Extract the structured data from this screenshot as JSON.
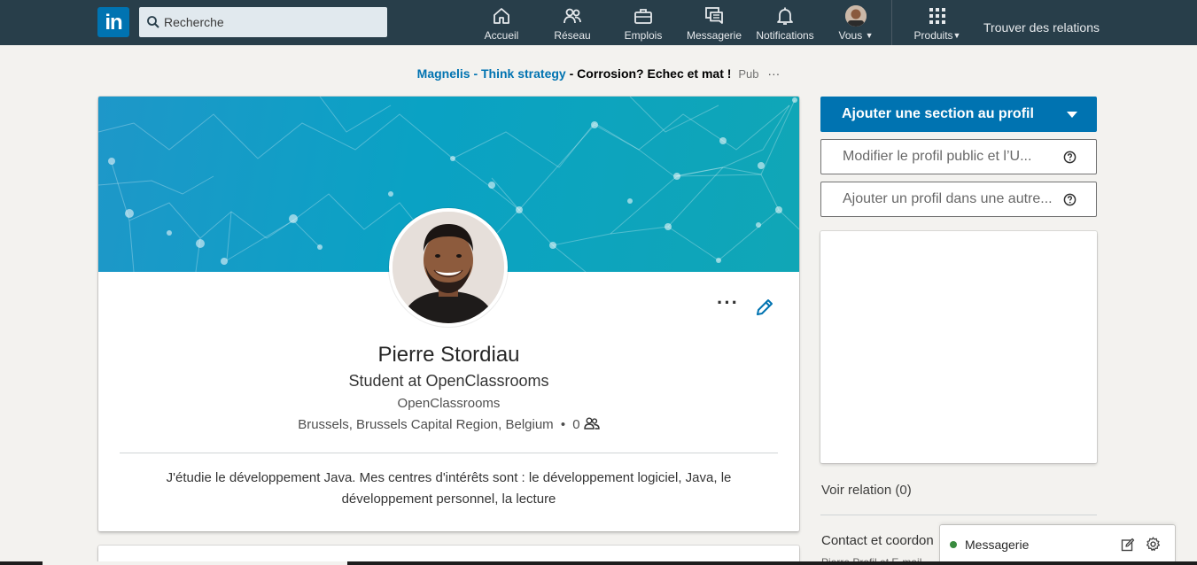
{
  "nav": {
    "logo_text": "in",
    "search_placeholder": "Recherche",
    "items": [
      {
        "label": "Accueil",
        "icon": "home-icon"
      },
      {
        "label": "Réseau",
        "icon": "network-icon"
      },
      {
        "label": "Emplois",
        "icon": "briefcase-icon"
      },
      {
        "label": "Messagerie",
        "icon": "messaging-icon"
      },
      {
        "label": "Notifications",
        "icon": "bell-icon"
      },
      {
        "label": "Vous",
        "icon": "avatar"
      },
      {
        "label": "Produits",
        "icon": "grid-icon"
      }
    ],
    "find_connections": "Trouver des relations",
    "bar_color": "#283e4a",
    "brand_color": "#0073b1"
  },
  "ad": {
    "brand": "Magnelis - Think strategy",
    "separator": " - ",
    "title": "Corrosion? Echec et mat !",
    "pub": "Pub",
    "more": "···"
  },
  "profile": {
    "name": "Pierre Stordiau",
    "headline": "Student at OpenClassrooms",
    "company": "OpenClassrooms",
    "location": "Brussels, Brussels Capital Region, Belgium",
    "bullet": "•",
    "connections": "0",
    "summary": "J'étudie le développement Java. Mes centres d'intérêts sont : le développement logiciel, Java, le développement personnel, la lecture",
    "more_label": "···"
  },
  "sidebar": {
    "add_section": "Ajouter une section au profil",
    "edit_public": "Modifier le profil public et l’U...",
    "add_language": "Ajouter un profil dans une autre...",
    "see_connections": "Voir relation (0)",
    "contact": "Contact et coordon",
    "contact_sub": "Pierre Profil et E-mail"
  },
  "messaging": {
    "label": "Messagerie",
    "status_color": "#398b3e"
  }
}
